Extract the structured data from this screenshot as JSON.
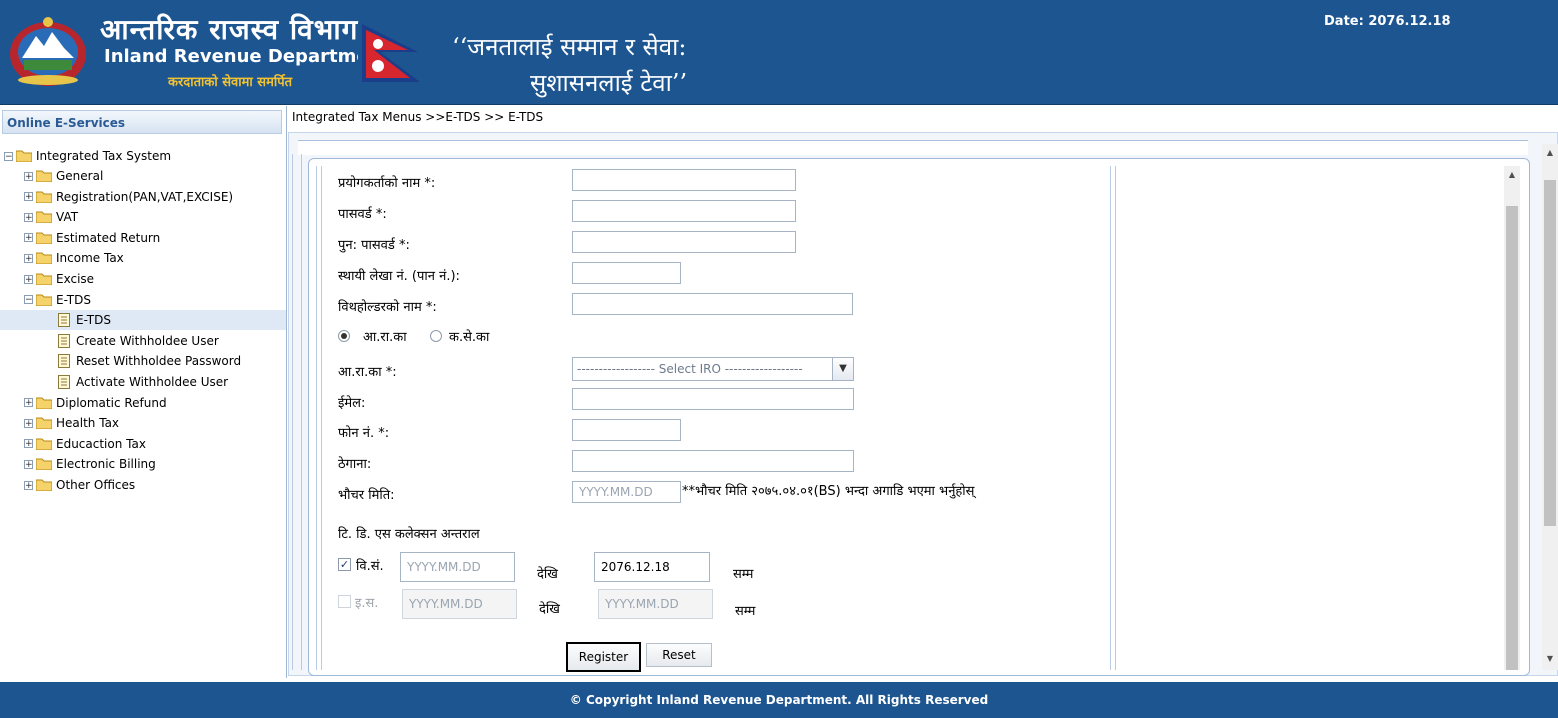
{
  "header": {
    "title_np": "आन्तरिक राजस्व विभाग",
    "title_en": "Inland Revenue Department",
    "subtitle_np": "करदाताको सेवामा समर्पित",
    "motto_line1": "‘‘जनतालाई सम्मान र सेवा:",
    "motto_line2": "सुशासनलाई टेवा’’",
    "date": "Date:  2076.12.18"
  },
  "sidebar": {
    "title": "Online E-Services",
    "root": "Integrated Tax System",
    "items": [
      {
        "label": "General",
        "expander": "+"
      },
      {
        "label": "Registration(PAN,VAT,EXCISE)",
        "expander": "+"
      },
      {
        "label": "VAT",
        "expander": "+"
      },
      {
        "label": "Estimated Return",
        "expander": "+"
      },
      {
        "label": "Income Tax",
        "expander": "+"
      },
      {
        "label": "Excise",
        "expander": "+"
      },
      {
        "label": "E-TDS",
        "expander": "−"
      },
      {
        "label": "Diplomatic Refund",
        "expander": "+"
      },
      {
        "label": "Health Tax",
        "expander": "+"
      },
      {
        "label": "Educaction Tax",
        "expander": "+"
      },
      {
        "label": "Electronic Billing",
        "expander": "+"
      },
      {
        "label": "Other Offices",
        "expander": "+"
      }
    ],
    "etds_children": [
      "E-TDS",
      "Create Withholdee User",
      "Reset Withholdee Password",
      "Activate Withholdee User"
    ]
  },
  "breadcrumb": "Integrated Tax Menus >>E-TDS >> E-TDS",
  "form": {
    "username_label": "प्रयोगकर्ताको नाम *:",
    "password_label": "पासवर्ड *:",
    "repassword_label": "पुन: पासवर्ड *:",
    "pan_label": "स्थायी लेखा नं. (पान नं.):",
    "withholder_label": "विथहोल्डरको नाम *:",
    "radio_iro": "आ.रा.का",
    "radio_tso": "क.से.का",
    "iro_label": "आ.रा.का *:",
    "iro_select": "------------------ Select IRO ------------------",
    "email_label": "ईमेल:",
    "phone_label": "फोन नं. *:",
    "address_label": "ठेगाना:",
    "voucher_label": "भौचर मिति:",
    "voucher_placeholder": "YYYY.MM.DD",
    "voucher_note": "**भौचर मिति २०७५.०४.०१(BS) भन्दा अगाडि भएमा भर्नुहोस्",
    "interval_label": "टि. डि. एस कलेक्सन अन्तराल",
    "bs_label": "वि.सं.",
    "bs_from_placeholder": "YYYY.MM.DD",
    "bs_to_value": "2076.12.18",
    "ad_label": "इ.स.",
    "ad_from_placeholder": "YYYY.MM.DD",
    "ad_to_placeholder": "YYYY.MM.DD",
    "from_word": "देखि",
    "to_word": "सम्म",
    "register_label": "Register",
    "reset_label": "Reset"
  },
  "footer": "© Copyright Inland Revenue Department. All Rights Reserved",
  "colors": {
    "header_bg": "#1d5591",
    "subtitle": "#f1c232"
  }
}
